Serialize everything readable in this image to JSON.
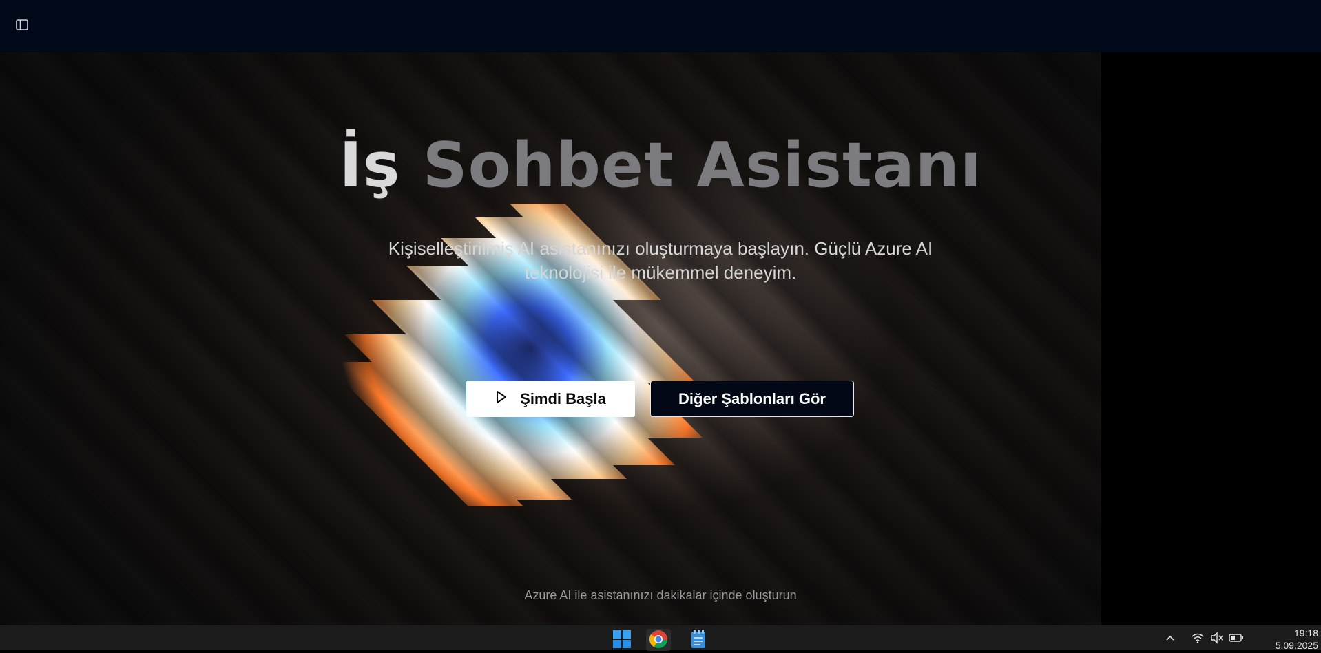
{
  "app": {
    "sidebar_toggle_icon": "sidebar-toggle-icon"
  },
  "hero": {
    "title_word1": "İş",
    "title_rest": "Sohbet Asistanı",
    "subtitle": "Kişiselleştirilmiş AI asistanınızı oluşturmaya başlayın. Güçlü Azure AI teknolojisi ile mükemmel deneyim.",
    "primary_button": "Şimdi Başla",
    "primary_button_icon": "play-icon",
    "secondary_button": "Diğer Şablonları Gör",
    "footer": "Azure AI ile asistanınızı dakikalar içinde oluşturun"
  },
  "taskbar": {
    "apps": [
      {
        "name": "windows-start",
        "icon": "windows-logo-icon"
      },
      {
        "name": "chrome",
        "icon": "chrome-icon",
        "active": true
      },
      {
        "name": "notepad",
        "icon": "notepad-icon"
      }
    ],
    "tray_icons": [
      "chevron-up-icon",
      "wifi-icon",
      "speaker-muted-icon",
      "battery-icon"
    ],
    "time": "19:18",
    "date": "5.09.2025"
  },
  "colors": {
    "topbar": "#020a1a",
    "button_primary_bg": "#ffffff",
    "button_secondary_bg": "#020816",
    "title_highlight": "#d9d9d9",
    "title_muted": "#7b7b80"
  }
}
